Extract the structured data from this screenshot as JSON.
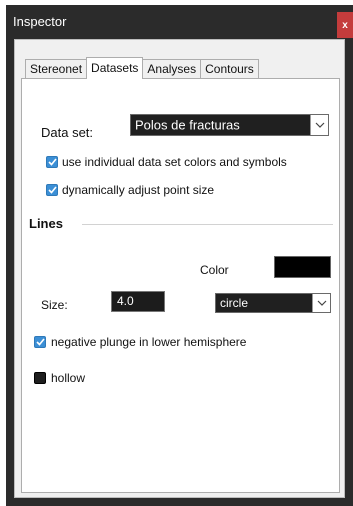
{
  "window": {
    "title": "Inspector",
    "close_label": "x"
  },
  "tabs": [
    {
      "label": "Stereonet",
      "active": false
    },
    {
      "label": "Datasets",
      "active": true
    },
    {
      "label": "Analyses",
      "active": false
    },
    {
      "label": "Contours",
      "active": false
    }
  ],
  "dataset": {
    "label": "Data set:",
    "selected": "Polos de fracturas",
    "use_individual_colors": {
      "label": "use individual data set colors and symbols",
      "checked": true
    },
    "dynamic_point_size": {
      "label": "dynamically adjust point size",
      "checked": true
    }
  },
  "lines": {
    "section_title": "Lines",
    "color_label": "Color",
    "color_value": "#000000",
    "size_label": "Size:",
    "size_value": "4.0",
    "symbol_selected": "circle",
    "negative_plunge": {
      "label": "negative plunge in lower hemisphere",
      "checked": true
    },
    "hollow": {
      "label": "hollow",
      "checked": false
    }
  },
  "icons": {
    "checkmark": "checkmark-icon",
    "dropdown": "chevron-down-icon",
    "close": "close-icon"
  }
}
